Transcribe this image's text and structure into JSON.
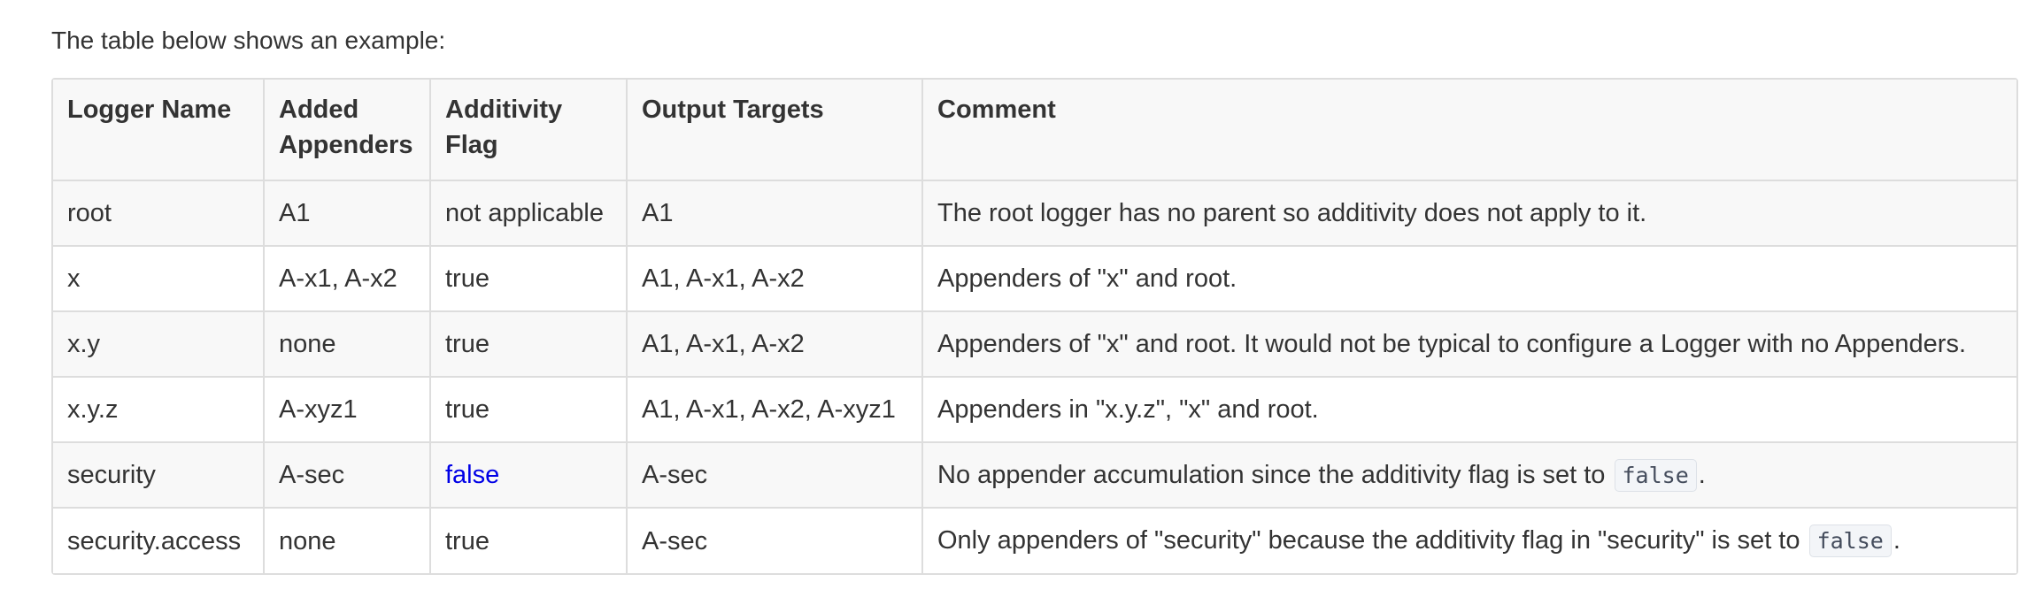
{
  "intro": "The table below shows an example:",
  "table": {
    "headers": {
      "logger_name": "Logger Name",
      "added_appenders": "Added Appenders",
      "additivity_flag": "Additivity Flag",
      "output_targets": "Output Targets",
      "comment": "Comment"
    },
    "rows": [
      {
        "logger": "root",
        "appenders": "A1",
        "flag": "not applicable",
        "targets": "A1",
        "comment": "The root logger has no parent so additivity does not apply to it."
      },
      {
        "logger": "x",
        "appenders": "A-x1, A-x2",
        "flag": "true",
        "targets": "A1, A-x1, A-x2",
        "comment": "Appenders of \"x\" and root."
      },
      {
        "logger": "x.y",
        "appenders": "none",
        "flag": "true",
        "targets": "A1, A-x1, A-x2",
        "comment": "Appenders of \"x\" and root. It would not be typical to configure a Logger with no Appenders."
      },
      {
        "logger": "x.y.z",
        "appenders": "A-xyz1",
        "flag": "true",
        "targets": "A1, A-x1, A-x2, A-xyz1",
        "comment": "Appenders in \"x.y.z\", \"x\" and root."
      },
      {
        "logger": "security",
        "appenders": "A-sec",
        "flag": "false",
        "flag_color": "#0000e6",
        "targets": "A-sec",
        "comment_text": "No appender accumulation since the additivity flag is set to",
        "comment_code": "false",
        "comment_end": "."
      },
      {
        "logger": "security.access",
        "appenders": "none",
        "flag": "true",
        "targets": "A-sec",
        "comment_text": "Only appenders of \"security\" because the additivity flag in \"security\" is set to",
        "comment_code": "false",
        "comment_end": "."
      }
    ]
  }
}
